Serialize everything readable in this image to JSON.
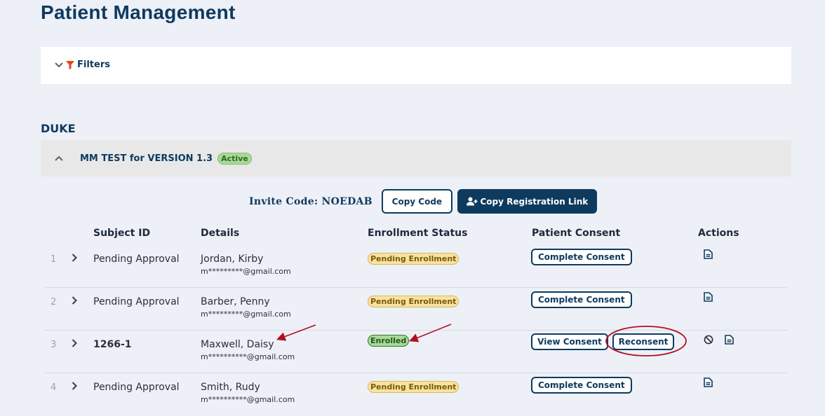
{
  "page": {
    "title": "Patient Management"
  },
  "filters": {
    "label": "Filters"
  },
  "org": {
    "name": "DUKE"
  },
  "study": {
    "name": "MM TEST for VERSION 1.3",
    "status": "Active"
  },
  "invite": {
    "label": "Invite Code: NOEDAB",
    "copy_code_label": "Copy Code",
    "copy_link_label": "Copy Registration Link"
  },
  "table": {
    "headers": {
      "subject_id": "Subject ID",
      "details": "Details",
      "enrollment_status": "Enrollment Status",
      "patient_consent": "Patient Consent",
      "actions": "Actions"
    },
    "rows": [
      {
        "num": "1",
        "subject": "Pending Approval",
        "name": "Jordan, Kirby",
        "email": "m*********@gmail.com",
        "status": "Pending Enrollment",
        "consent_button": "Complete Consent"
      },
      {
        "num": "2",
        "subject": "Pending Approval",
        "name": "Barber, Penny",
        "email": "m*********@gmail.com",
        "status": "Pending Enrollment",
        "consent_button": "Complete Consent"
      },
      {
        "num": "3",
        "subject": "1266-1",
        "name": "Maxwell, Daisy",
        "email": "m**********@gmail.com",
        "status": "Enrolled",
        "view_button": "View Consent",
        "reconsent_button": "Reconsent"
      },
      {
        "num": "4",
        "subject": "Pending Approval",
        "name": "Smith, Rudy",
        "email": "m**********@gmail.com",
        "status": "Pending Enrollment",
        "consent_button": "Complete Consent"
      }
    ]
  },
  "colors": {
    "primary": "#0e3a5e",
    "filter_icon": "#e04a12",
    "annotation": "#b01020",
    "active_badge": "#a9d89a",
    "pending_badge": "#f7e2a1"
  },
  "icons": {
    "filters_toggle": [
      "chevron-down-icon",
      "filter-icon"
    ],
    "study_collapse": "chevron-up-icon",
    "copy_link": "user-plus-icon",
    "row_expand": "chevron-right-icon",
    "row_actions": [
      "document-icon",
      "block-icon"
    ]
  }
}
